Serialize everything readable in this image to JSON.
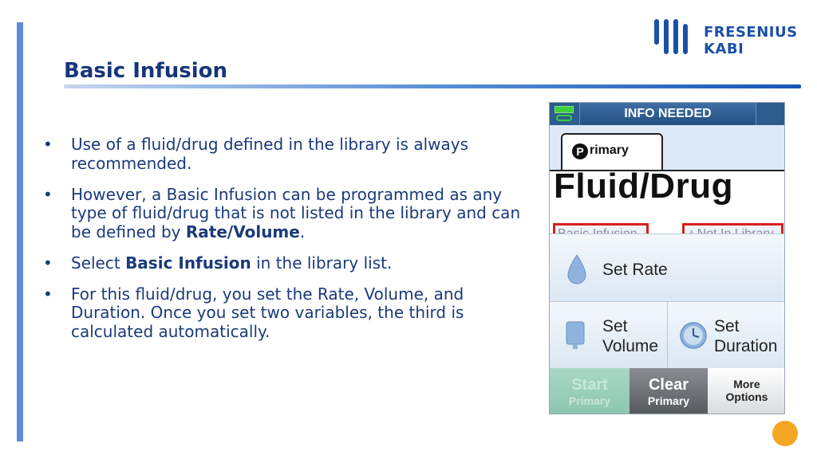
{
  "slide": {
    "title": "Basic Infusion",
    "bullets": [
      {
        "pre": "Use of a fluid/drug defined in the library is always recommended.",
        "bold": "",
        "post": ""
      },
      {
        "pre": "However, a Basic Infusion can be programmed as any type of fluid/drug that is not listed in the library and can be defined by ",
        "bold": "Rate/Volume",
        "post": "."
      },
      {
        "pre": "Select ",
        "bold": "Basic Infusion",
        "post": " in the library list."
      },
      {
        "pre": "For this fluid/drug, you set the Rate, Volume, and Duration. Once you set two variables, the third is calculated automatically.",
        "bold": "",
        "post": ""
      }
    ],
    "bullet_glyph": "•"
  },
  "logo": {
    "line1": "FRESENIUS",
    "line2": "KABI",
    "color": "#1b4fa8"
  },
  "device": {
    "header_status": "INFO NEEDED",
    "tab_badge": "P",
    "tab_label": "rimary",
    "fluid_title": "Fluid/Drug",
    "basic_infusion_label": "Basic Infusion",
    "not_in_library_label": "Not In Library",
    "warning_glyph": "⚠",
    "set_rate_label": "Set Rate",
    "set_volume_line1": "Set",
    "set_volume_line2": "Volume",
    "set_duration_line1": "Set",
    "set_duration_line2": "Duration",
    "start_big": "Start",
    "start_small": "Primary",
    "clear_big": "Clear",
    "clear_small": "Primary",
    "more_line1": "More",
    "more_line2": "Options",
    "battery_color": "#3ad13a",
    "alert_color": "#d42020"
  },
  "accent_colors": {
    "left_bar": "#5b8fd6",
    "title": "#16357a",
    "orange_dot": "#f5a623"
  }
}
